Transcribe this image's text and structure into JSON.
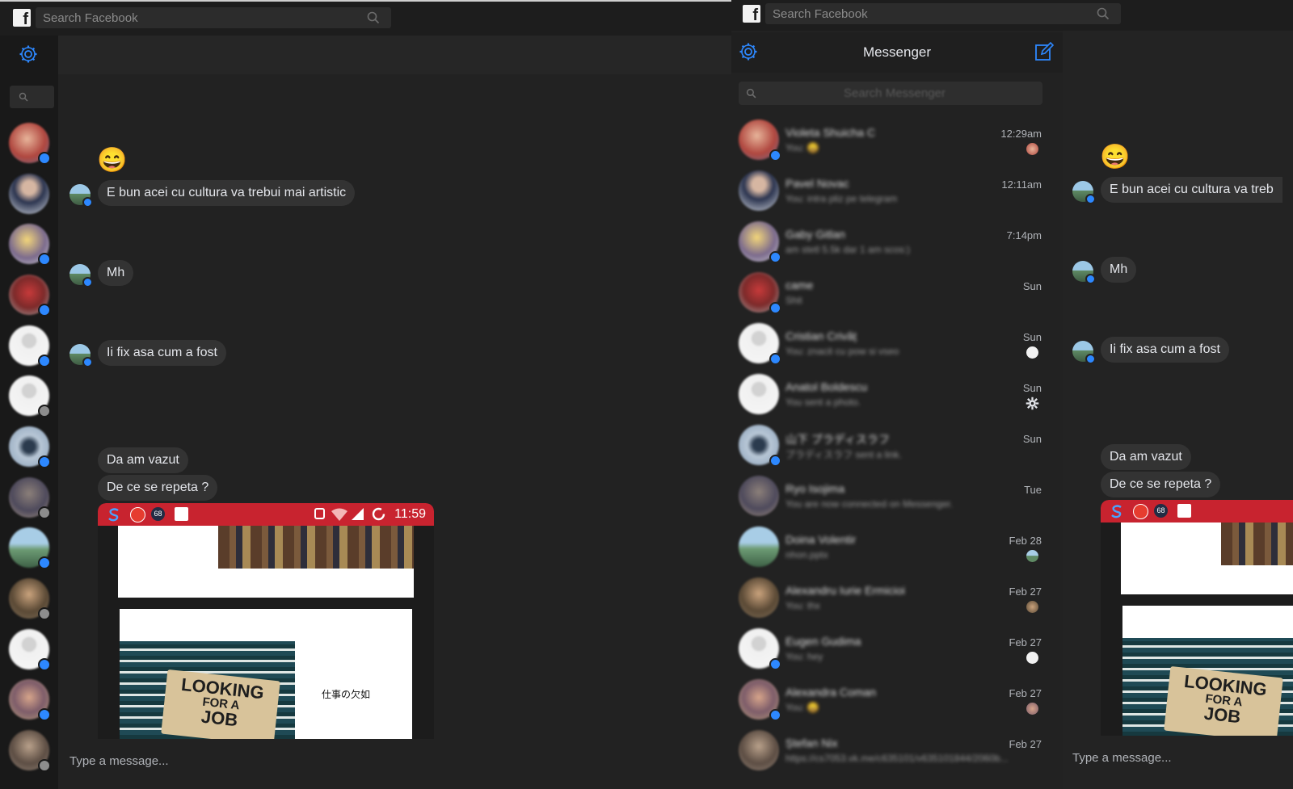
{
  "left_window": {
    "search_placeholder": "Search Facebook",
    "messages": [
      {
        "sender": "other",
        "text": "E bun acei cu cultura va trebui mai artistic"
      },
      {
        "sender": "other",
        "text": "Mh"
      },
      {
        "sender": "other",
        "text": "Ii fix asa cum a fost"
      },
      {
        "sender": "other",
        "text": "Da am vazut"
      },
      {
        "sender": "other",
        "text": "De ce se repeta ?"
      }
    ],
    "emoji": "😄",
    "attachment": {
      "status_time": "11:59",
      "notification_count": "68",
      "caption": "仕事の欠如",
      "sign_line1": "LOOKING",
      "sign_line2": "FOR A",
      "sign_line3": "JOB"
    },
    "composer_placeholder": "Type a message..."
  },
  "right_window": {
    "search_placeholder": "Search Facebook",
    "title": "Messenger",
    "thread_search_placeholder": "Search Messenger",
    "threads": [
      {
        "name": "Violeta Shuicha C",
        "preview": "You: 😀",
        "time": "12:29am"
      },
      {
        "name": "Pavel Novac",
        "preview": "You: intra pliz pe telegram",
        "time": "12:11am"
      },
      {
        "name": "Gaby Gitlan",
        "preview": "am stetl 5.5k dar 1 am scos:)",
        "time": "7:14pm"
      },
      {
        "name": "came",
        "preview": "Shit",
        "time": "Sun"
      },
      {
        "name": "Cristian Crivăț",
        "preview": "You: znacit cu pow si vseo",
        "time": "Sun"
      },
      {
        "name": "Anatol Boldescu",
        "preview": "You sent a photo.",
        "time": "Sun"
      },
      {
        "name": "山下 プラディスラフ",
        "preview": "プラディスラフ sent a link.",
        "time": "Sun"
      },
      {
        "name": "Ryo Isojima",
        "preview": "You are now connected on Messenger.",
        "time": "Tue"
      },
      {
        "name": "Doina Volentir",
        "preview": "nhon.pptx",
        "time": "Feb 28"
      },
      {
        "name": "Alexandru Iurie Ermicioi",
        "preview": "You: thx",
        "time": "Feb 27"
      },
      {
        "name": "Eugen Gudima",
        "preview": "You: hey",
        "time": "Feb 27"
      },
      {
        "name": "Alexandra Coman",
        "preview": "You: 😀",
        "time": "Feb 27"
      },
      {
        "name": "Ștefan Nix",
        "preview": "https://cs7053.vk.me/c635101/v635101844/2060b...",
        "time": "Feb 27"
      }
    ],
    "messages": [
      {
        "sender": "other",
        "text": "E bun acei cu cultura va treb"
      },
      {
        "sender": "other",
        "text": "Mh"
      },
      {
        "sender": "other",
        "text": "Ii fix asa cum a fost"
      },
      {
        "sender": "other",
        "text": "Da am vazut"
      },
      {
        "sender": "other",
        "text": "De ce se repeta ?"
      }
    ],
    "emoji": "😄",
    "attachment": {
      "notification_count": "68",
      "sign_line1": "LOOKING",
      "sign_line2": "FOR A",
      "sign_line3": "JOB"
    },
    "composer_placeholder": "Type a message..."
  },
  "colors": {
    "accent": "#2d88ff",
    "bubble": "#333333",
    "background": "#222222",
    "statusbar": "#c8232f"
  }
}
